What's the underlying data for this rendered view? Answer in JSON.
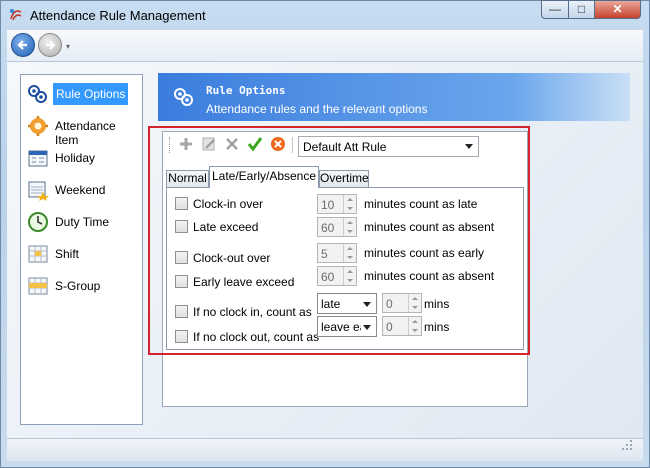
{
  "window": {
    "title": "Attendance Rule Management"
  },
  "titlebar_buttons": {
    "minimize": "—",
    "maximize": "□",
    "close": "✕"
  },
  "nav": {
    "dropdown_arrow": "▾"
  },
  "left_nav": {
    "items": [
      {
        "label": "Rule Options",
        "icon": "rule-options-icon",
        "active": true
      },
      {
        "label": "Attendance Item",
        "icon": "attendance-item-icon"
      },
      {
        "label": "Holiday",
        "icon": "holiday-icon"
      },
      {
        "label": "Weekend",
        "icon": "weekend-icon"
      },
      {
        "label": "Duty Time",
        "icon": "clock-icon"
      },
      {
        "label": "Shift",
        "icon": "shift-icon"
      },
      {
        "label": "S-Group",
        "icon": "shift-group-icon"
      }
    ]
  },
  "header": {
    "title": "Rule Options",
    "subtitle": "Attendance rules and the relevant options"
  },
  "toolbar": {
    "icons": [
      "add-icon",
      "edit-icon",
      "delete-icon",
      "confirm-check-icon",
      "cancel-icon"
    ],
    "rule_select": {
      "value": "Default Att Rule"
    }
  },
  "tabs": [
    {
      "label": "Normal"
    },
    {
      "label": "Late/Early/Absence",
      "active": true
    },
    {
      "label": "Overtime"
    }
  ],
  "form": {
    "clock_in_over": {
      "label": "Clock-in over",
      "value": "10",
      "suffix": "minutes count as late",
      "checked": false
    },
    "late_exceed": {
      "label": "Late exceed",
      "value": "60",
      "suffix": "minutes count as absent",
      "checked": false
    },
    "clock_out_over": {
      "label": "Clock-out over",
      "value": "5",
      "suffix": "minutes count as early",
      "checked": false
    },
    "early_leave_exceed": {
      "label": "Early leave exceed",
      "value": "60",
      "suffix": "minutes count as absent",
      "checked": false
    },
    "no_clock_in": {
      "label": "If no clock in, count as",
      "select": "late",
      "value": "0",
      "suffix": "mins",
      "checked": false
    },
    "no_clock_out": {
      "label": "If no clock out, count as",
      "select": "leave early",
      "value": "0",
      "suffix": "mins",
      "checked": false
    }
  },
  "colors": {
    "accent": "#3399ff",
    "header_start": "#3b7dde",
    "highlight": "#d3242c"
  }
}
